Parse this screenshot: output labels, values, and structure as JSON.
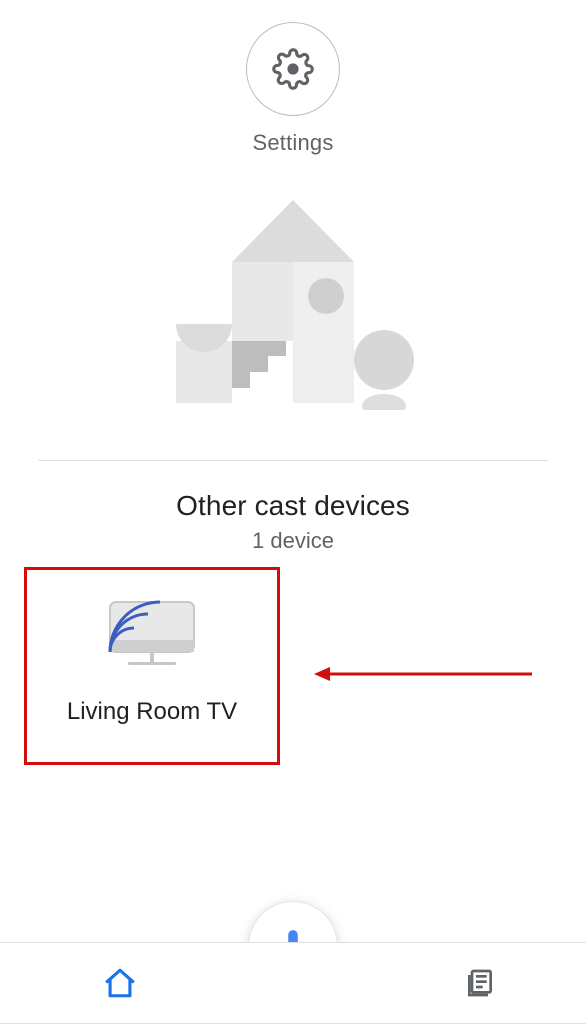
{
  "header": {
    "settings_label": "Settings"
  },
  "section": {
    "title": "Other cast devices",
    "subtitle": "1 device"
  },
  "devices": [
    {
      "name": "Living Room TV"
    }
  ],
  "nav": {
    "home_active": true
  },
  "icons": {
    "settings": "gear-icon",
    "cast_tv": "cast-tv-icon",
    "mic": "mic-icon",
    "home": "home-icon",
    "feed": "feed-icon"
  },
  "colors": {
    "accent_blue": "#1a73e8",
    "highlight_red": "#d40c0c",
    "text_primary": "#202124",
    "text_secondary": "#5f6368",
    "illustration_light": "#e8e8e8",
    "illustration_mid": "#dcdcdc",
    "illustration_dark": "#bdbdbd",
    "cast_arc": "#3b5fc0"
  }
}
